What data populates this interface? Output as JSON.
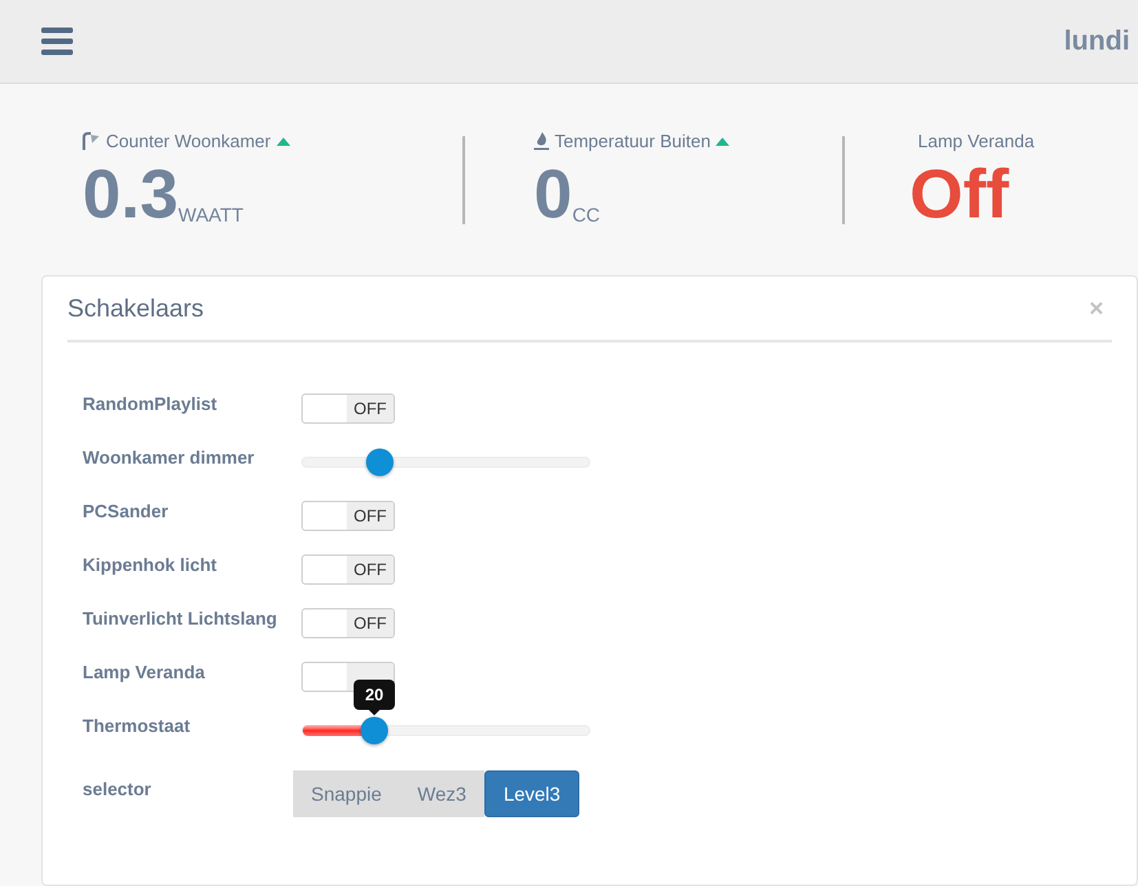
{
  "header": {
    "day": "lundi"
  },
  "stats": [
    {
      "kind": "counter",
      "label": "Counter Woonkamer",
      "rising": true,
      "value": "0.3",
      "unit": "WAATT"
    },
    {
      "kind": "temperature",
      "label": "Temperatuur Buiten",
      "rising": true,
      "value": "0",
      "unit": "CC"
    },
    {
      "kind": "state",
      "label": "Lamp Veranda",
      "value": "Off"
    }
  ],
  "panel": {
    "title": "Schakelaars",
    "close": "×",
    "rows": [
      {
        "kind": "switch",
        "label": "RandomPlaylist",
        "on": false,
        "state_text": "OFF"
      },
      {
        "kind": "slider",
        "label": "Woonkamer dimmer",
        "level": 0.27,
        "colored_fill": false
      },
      {
        "kind": "switch",
        "label": "PCSander",
        "on": false,
        "state_text": "OFF"
      },
      {
        "kind": "switch",
        "label": "Kippenhok licht",
        "on": false,
        "state_text": "OFF"
      },
      {
        "kind": "switch",
        "label": "Tuinverlicht Lichtslang",
        "on": false,
        "state_text": "OFF"
      },
      {
        "kind": "switch",
        "label": "Lamp Veranda",
        "on": false
      },
      {
        "kind": "slider",
        "label": "Thermostaat",
        "level": 0.25,
        "colored_fill": true,
        "tooltip": "20"
      },
      {
        "kind": "selector",
        "label": "selector",
        "options": [
          {
            "label": "Snappie",
            "selected": false
          },
          {
            "label": "Wez3",
            "selected": false
          },
          {
            "label": "Level3",
            "selected": true
          }
        ]
      }
    ]
  }
}
